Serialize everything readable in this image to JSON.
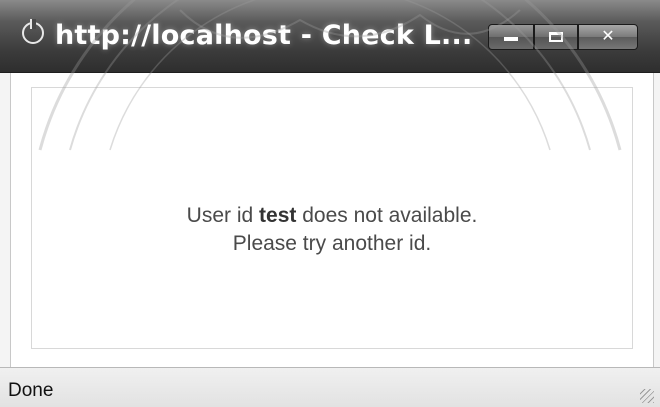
{
  "window": {
    "title": "http://localhost - Check L...",
    "minimize_symbol": "minimize",
    "maximize_symbol": "maximize",
    "close_symbol": "✕"
  },
  "message": {
    "prefix": "User id ",
    "user_id": "test",
    "suffix": " does not available.",
    "line2": "Please try another id."
  },
  "status": {
    "text": "Done"
  },
  "colors": {
    "titlebar": "#3c3c3c",
    "text": "#4a4a4a",
    "background": "#ffffff"
  },
  "icons": [
    "browser-app-icon",
    "minimize-icon",
    "maximize-icon",
    "close-icon",
    "resize-grip-icon"
  ]
}
